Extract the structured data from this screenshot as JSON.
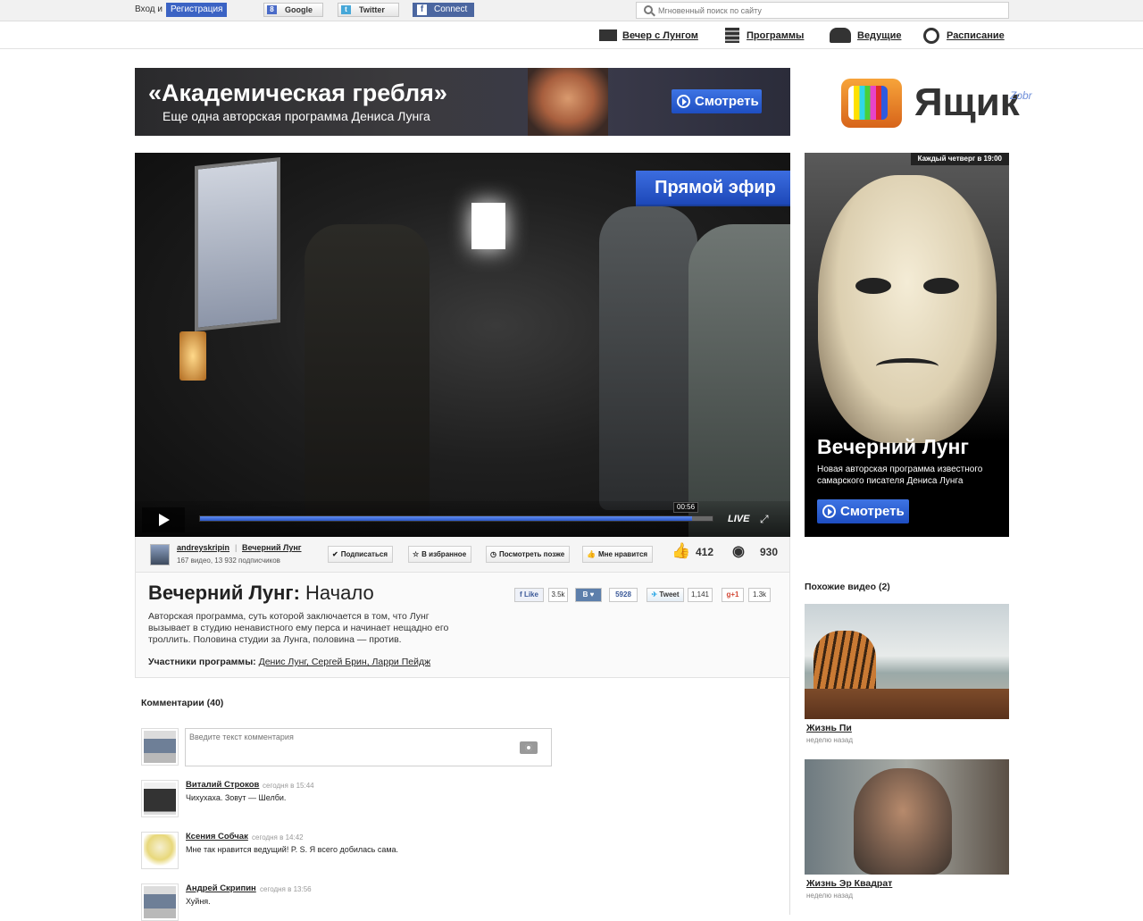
{
  "topbar": {
    "login": "Вход и",
    "register": "Регистрация",
    "google": "Google",
    "twitter": "Twitter",
    "facebook": "Connect",
    "search_placeholder": "Мгновенный поиск по сайту"
  },
  "nav": {
    "items": [
      {
        "label": "Вечер с Лунгом",
        "icon": "video-camera-icon"
      },
      {
        "label": "Программы",
        "icon": "film-icon"
      },
      {
        "label": "Ведущие",
        "icon": "users-icon"
      },
      {
        "label": "Расписание",
        "icon": "clock-icon"
      }
    ]
  },
  "banner": {
    "title": "«Академическая гребля»",
    "subtitle": "Еще одна авторская программа Дениса Лунга",
    "button": "Смотреть"
  },
  "logo": {
    "word": "Ящик",
    "badge": "Zobr"
  },
  "player": {
    "live_badge": "Прямой эфир",
    "time": "00:56",
    "progress": 0.96,
    "live_label": "LIVE"
  },
  "uploader": {
    "name": "andreyskripin",
    "channel": "Вечерний Лунг",
    "stats": "167 видео, 13 932 подписчиков"
  },
  "actions": {
    "subscribe": "Подписаться",
    "favorite": "В избранное",
    "later": "Посмотреть позже",
    "like": "Мне нравится",
    "likes_count": "412",
    "views_count": "930"
  },
  "video": {
    "title_bold": "Вечерний Лунг:",
    "title_rest": " Начало",
    "description": "Авторская программа, суть которой заключается в том, что Лунг вызывает в студию ненавистного ему перса и начинает нещадно его троллить. Половина студии за Лунга, половина — против.",
    "members_label": "Участники программы:",
    "members": "Денис Лунг, Сергей Брин, Ларри Пейдж"
  },
  "social": {
    "fb_like": "Like",
    "fb_count": "3.5k",
    "vk": "В",
    "vk_count": "5928",
    "tweet": "Tweet",
    "tweet_count": "1,141",
    "gplus": "+1",
    "gplus_count": "1.3k"
  },
  "comments": {
    "header": "Комментарии (40)",
    "placeholder": "Введите текст комментария",
    "items": [
      {
        "name": "Виталий Строков",
        "time": "сегодня в 15:44",
        "text": "Чихухаха. Зовут — Шелби."
      },
      {
        "name": "Ксения Собчак",
        "time": "сегодня в 14:42",
        "text": "Мне так нравится ведущий! P. S. Я всего добилась сама."
      },
      {
        "name": "Андрей Скрипин",
        "time": "сегодня в 13:56",
        "text": "Хуйня."
      }
    ]
  },
  "promo": {
    "tag": "Каждый четверг в 19:00",
    "title": "Вечерний Лунг",
    "subtitle": "Новая авторская программа известного самарского писателя Дениса Лунга",
    "button": "Смотреть"
  },
  "similar": {
    "header": "Похожие видео (2)",
    "items": [
      {
        "title": "Жизнь Пи",
        "time": "неделю назад"
      },
      {
        "title": "Жизнь Эр Квадрат",
        "time": "неделю назад"
      }
    ]
  },
  "colors": {
    "accent": "#3b63c4",
    "live": "#2c58c8"
  }
}
